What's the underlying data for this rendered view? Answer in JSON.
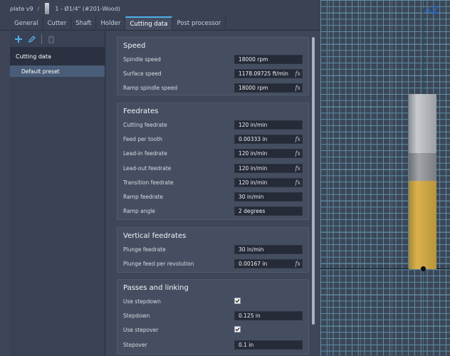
{
  "titlebar": {
    "doc": "plate v9",
    "separator": "/",
    "tool": "1 - Ø1/4\" (#201-Wood)"
  },
  "tabs": [
    "General",
    "Cutter",
    "Shaft",
    "Holder",
    "Cutting data",
    "Post processor"
  ],
  "active_tab": "Cutting data",
  "left_pane": {
    "header": "Cutting data",
    "items": [
      "Default preset"
    ],
    "toolbar_icons": [
      "add-icon",
      "edit-icon",
      "delete-icon"
    ]
  },
  "sections": {
    "speed": {
      "title": "Speed",
      "rows": [
        {
          "label": "Spindle speed",
          "value": "18000 rpm",
          "fx": false
        },
        {
          "label": "Surface speed",
          "value": "1178.09725 ft/min",
          "fx": true
        },
        {
          "label": "Ramp spindle speed",
          "value": "18000 rpm",
          "fx": true
        }
      ]
    },
    "feedrates": {
      "title": "Feedrates",
      "rows": [
        {
          "label": "Cutting feedrate",
          "value": "120 in/min",
          "fx": false
        },
        {
          "label": "Feed per tooth",
          "value": "0.00333 in",
          "fx": true
        },
        {
          "label": "Lead-in feedrate",
          "value": "120 in/min",
          "fx": true
        },
        {
          "label": "Lead-out feedrate",
          "value": "120 in/min",
          "fx": true
        },
        {
          "label": "Transition feedrate",
          "value": "120 in/min",
          "fx": true
        },
        {
          "label": "Ramp feedrate",
          "value": "30 in/min",
          "fx": false
        },
        {
          "label": "Ramp angle",
          "value": "2 degrees",
          "fx": false
        }
      ]
    },
    "vertical": {
      "title": "Vertical feedrates",
      "rows": [
        {
          "label": "Plunge feedrate",
          "value": "30 in/min",
          "fx": false
        },
        {
          "label": "Plunge feed per revolution",
          "value": "0.00167 in",
          "fx": true
        }
      ]
    },
    "passes": {
      "title": "Passes and linking",
      "rows": [
        {
          "label": "Use stepdown",
          "checked": true
        },
        {
          "label": "Stepdown",
          "value": "0.125 in",
          "fx": false
        },
        {
          "label": "Use stepover",
          "checked": true
        },
        {
          "label": "Stepover",
          "value": "0.1 in",
          "fx": false
        }
      ]
    }
  },
  "viewport": {
    "axis_label": "+Z"
  },
  "colors": {
    "accent": "#4fb0ea",
    "flute": "#dab24c",
    "axis": "#1e6cf2"
  }
}
